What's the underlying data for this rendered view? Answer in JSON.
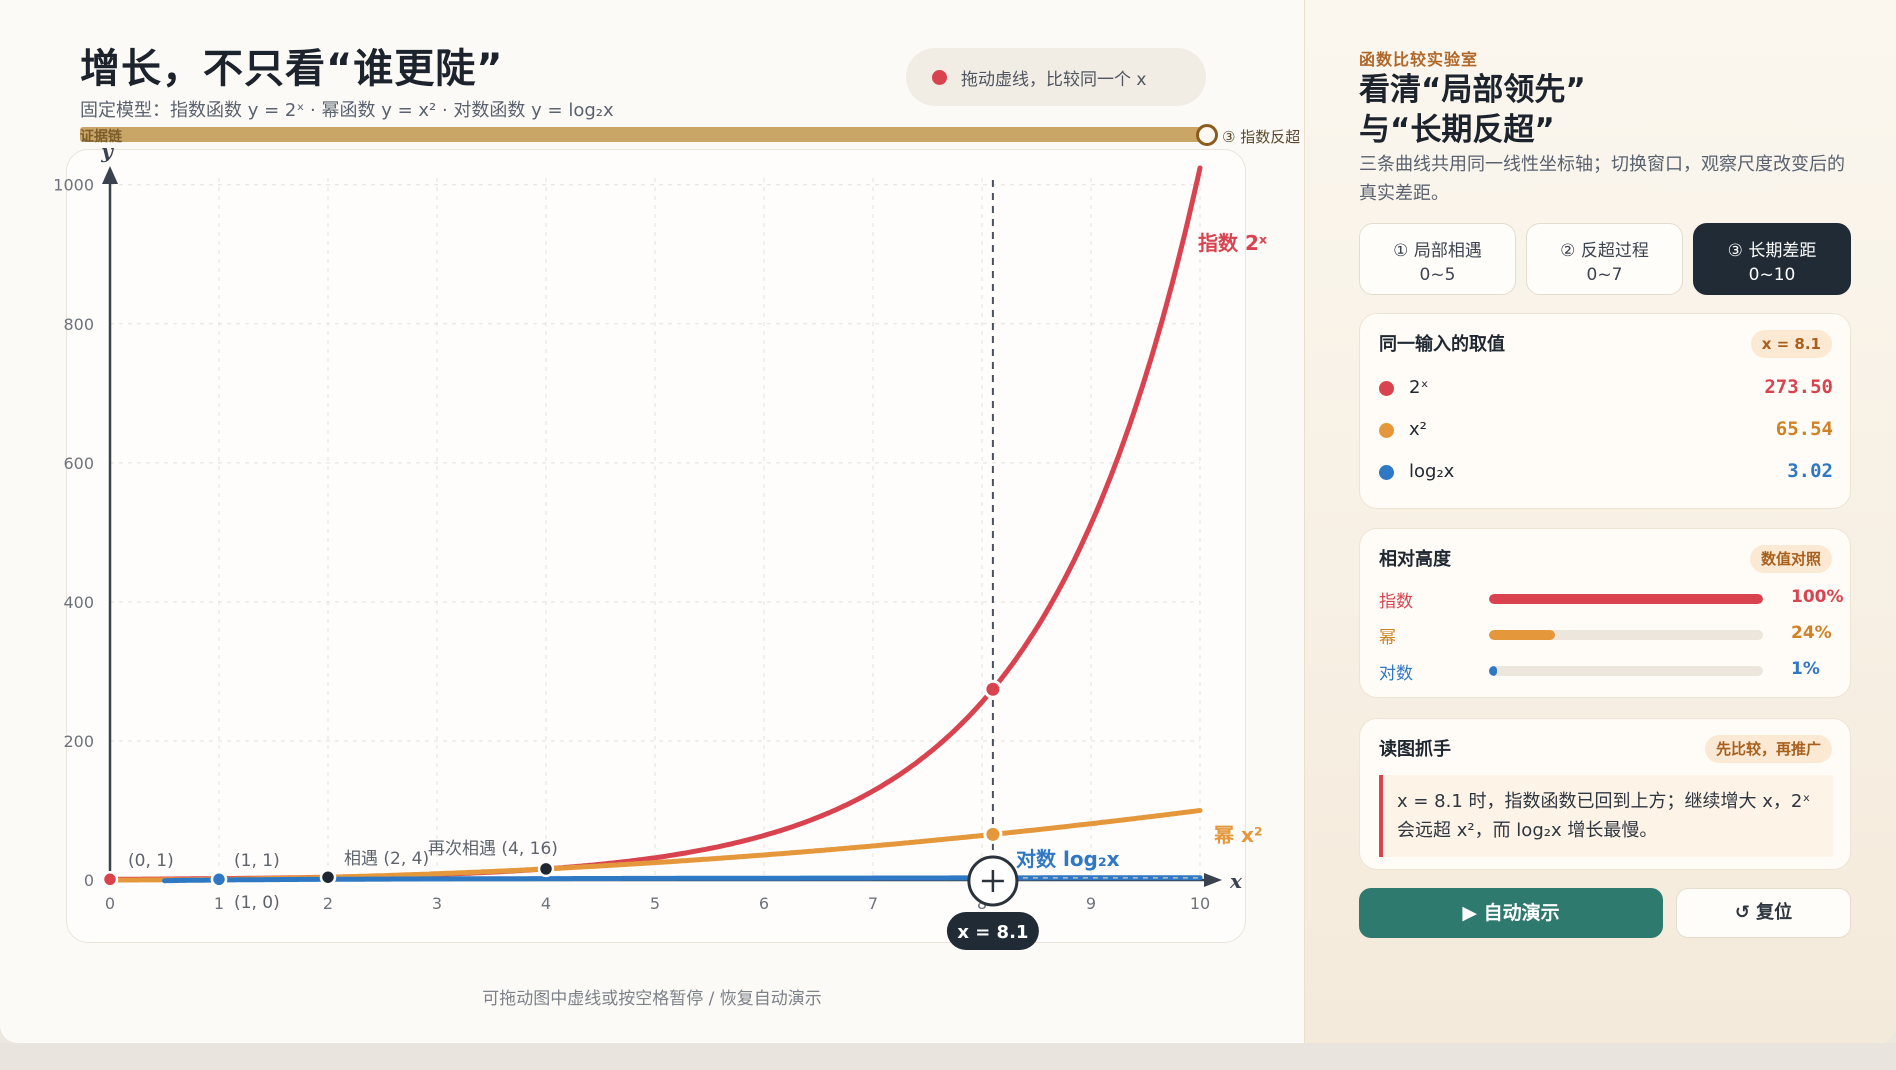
{
  "header": {
    "title": "增长，不只看“谁更陡”",
    "subtitle": "固定模型：指数函数 y = 2ˣ · 幂函数 y = x² · 对数函数 y = log₂x",
    "hint": "拖动虚线，比较同一个 x"
  },
  "evidence_chain": {
    "label": "证据链",
    "end_label": "③ 指数反超"
  },
  "chart_data": {
    "type": "line",
    "xlabel": "x",
    "ylabel": "y",
    "xlim": [
      0,
      10
    ],
    "ylim": [
      0,
      1024
    ],
    "xticks": [
      0,
      1,
      2,
      3,
      4,
      5,
      6,
      7,
      8,
      9,
      10
    ],
    "yticks": [
      0,
      200,
      400,
      600,
      800,
      1000
    ],
    "grid": true,
    "series": [
      {
        "id": "exp",
        "name": "指数 2ˣ",
        "formula": "2^x",
        "color": "#d8434f"
      },
      {
        "id": "pow",
        "name": "幂 x²",
        "formula": "x^2",
        "color": "#e4973b"
      },
      {
        "id": "log",
        "name": "对数 log₂x",
        "formula": "log2(x)",
        "color": "#2f78c4"
      }
    ],
    "points": [
      {
        "x": 0,
        "y": 1,
        "label": "(0, 1)",
        "color": "#d8434f"
      },
      {
        "x": 1,
        "y": 0,
        "label": "(1, 0)",
        "color": "#2f78c4"
      },
      {
        "x": 1,
        "y": 1,
        "label": "(1, 1)",
        "color": "#2f78c4"
      },
      {
        "x": 2,
        "y": 4,
        "label": "相遇 (2, 4)",
        "color": "#1f2731"
      },
      {
        "x": 4,
        "y": 16,
        "label": "再次相遇 (4, 16)",
        "color": "#1f2731"
      }
    ],
    "cursor": {
      "x": 8.1,
      "label": "x = 8.1"
    }
  },
  "footer_hint": "可拖动图中虚线或按空格暂停 / 恢复自动演示",
  "panel": {
    "eyebrow": "函数比较实验室",
    "title_line1": "看清“局部领先”",
    "title_line2": "与“长期反超”",
    "description": "三条曲线共用同一线性坐标轴；切换窗口，观察尺度改变后的真实差距。",
    "tabs": [
      {
        "label": "① 局部相遇",
        "range": "0~5",
        "active": false
      },
      {
        "label": "② 反超过程",
        "range": "0~7",
        "active": false
      },
      {
        "label": "③ 长期差距",
        "range": "0~10",
        "active": true
      }
    ],
    "values_card": {
      "title": "同一输入的取值",
      "badge": "x = 8.1",
      "rows": [
        {
          "label": "2ˣ",
          "value": "273.50",
          "color": "#d8434f"
        },
        {
          "label": "x²",
          "value": "65.54",
          "color": "#e4973b"
        },
        {
          "label": "log₂x",
          "value": "3.02",
          "color": "#2f78c4"
        }
      ]
    },
    "relative_card": {
      "title": "相对高度",
      "badge": "数值对照",
      "rows": [
        {
          "label": "指数",
          "percent": 100,
          "percent_label": "100%",
          "color": "#d8434f"
        },
        {
          "label": "幂",
          "percent": 24,
          "percent_label": "24%",
          "color": "#e4973b"
        },
        {
          "label": "对数",
          "percent": 1,
          "percent_label": "1%",
          "color": "#2f78c4"
        }
      ]
    },
    "tip_card": {
      "title": "读图抓手",
      "badge": "先比较，再推广",
      "text": "x = 8.1 时，指数函数已回到上方；继续增大 x，2ˣ 会远超 x²，而 log₂x 增长最慢。"
    },
    "play_button": "▶ 自动演示",
    "reset_button": "↺ 复位"
  }
}
